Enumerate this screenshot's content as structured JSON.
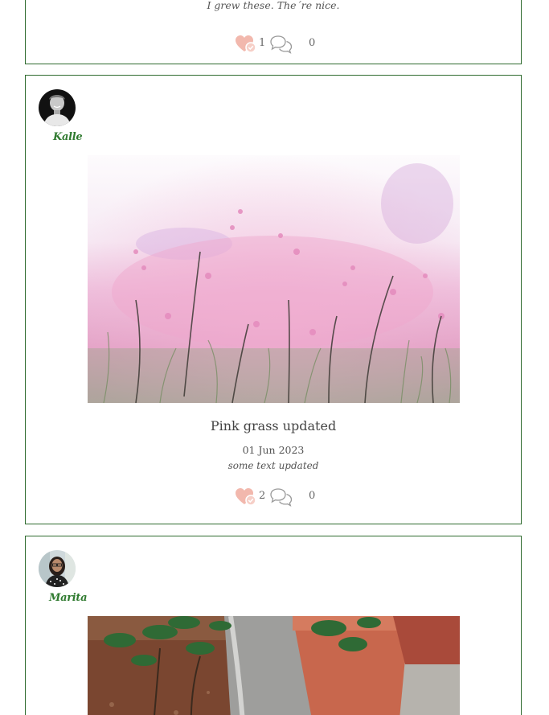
{
  "posts": [
    {
      "caption": "I grew these. The´re nice.",
      "likes": "1",
      "comments": "0"
    },
    {
      "author": "Kalle",
      "avatar_icon": "avatar-man-photo",
      "image_icon": "pink-grass-photo",
      "title": "Pink grass updated",
      "date": "01 Jun 2023",
      "text": "some text updated",
      "likes": "2",
      "comments": "0"
    },
    {
      "author": "Marita",
      "avatar_icon": "avatar-woman-photo",
      "image_icon": "potted-plants-photo"
    }
  ],
  "colors": {
    "border": "#2e6b2e",
    "author_name": "#2f7a2f",
    "heart": "#f2b8ad",
    "comment_icon": "#9a9a9a"
  }
}
